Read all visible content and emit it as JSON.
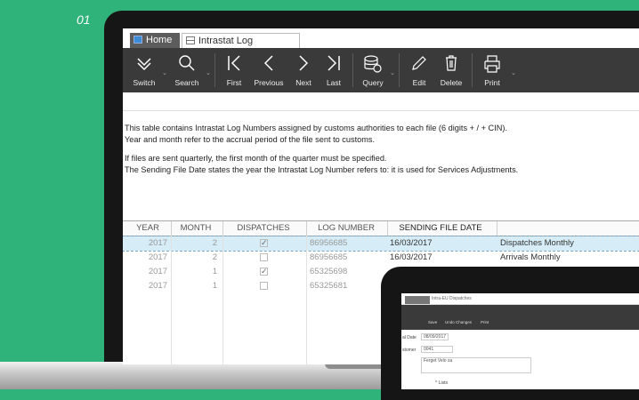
{
  "slide_number": "01",
  "tabs": {
    "home": "Home",
    "log": "Intrastat Log Numbers"
  },
  "toolbar": {
    "switch": "Switch",
    "search": "Search",
    "first": "First",
    "previous": "Previous",
    "next": "Next",
    "last": "Last",
    "query": "Query",
    "edit": "Edit",
    "delete": "Delete",
    "print": "Print"
  },
  "description": {
    "line1": "This table contains Intrastat Log Numbers assigned by customs authorities to each file (6 digits + / + CIN).",
    "line2": "Year and month refer to the accrual period of the file sent to customs.",
    "line3": "If files are sent quarterly, the first month of the quarter must be specified.",
    "line4": "The Sending File Date states the year the Intrastat Log Number refers to: it is used for Services Adjustments."
  },
  "table": {
    "headers": [
      "YEAR",
      "MONTH",
      "DISPATCHES",
      "LOG NUMBER",
      "SENDING FILE DATE"
    ],
    "rows": [
      {
        "year": "2017",
        "month": "2",
        "dispatches": true,
        "log": "86956685",
        "date": "16/03/2017",
        "desc": "Dispatches Monthly"
      },
      {
        "year": "2017",
        "month": "2",
        "dispatches": false,
        "log": "86956685",
        "date": "16/03/2017",
        "desc": "Arrivals Monthly"
      },
      {
        "year": "2017",
        "month": "1",
        "dispatches": true,
        "log": "65325698",
        "date": "",
        "desc": ""
      },
      {
        "year": "2017",
        "month": "1",
        "dispatches": false,
        "log": "65325681",
        "date": "",
        "desc": ""
      }
    ]
  },
  "tablet": {
    "tab": "Intra-EU Dispatches",
    "buttons": [
      "Save",
      "Undo Changes",
      "Print"
    ],
    "date_label": "al Date",
    "date_value": "08/09/2017",
    "customer_label": "stomer",
    "customer_value": "0041",
    "customer_name": "Ferget Velo sa",
    "lists": "Lists"
  }
}
